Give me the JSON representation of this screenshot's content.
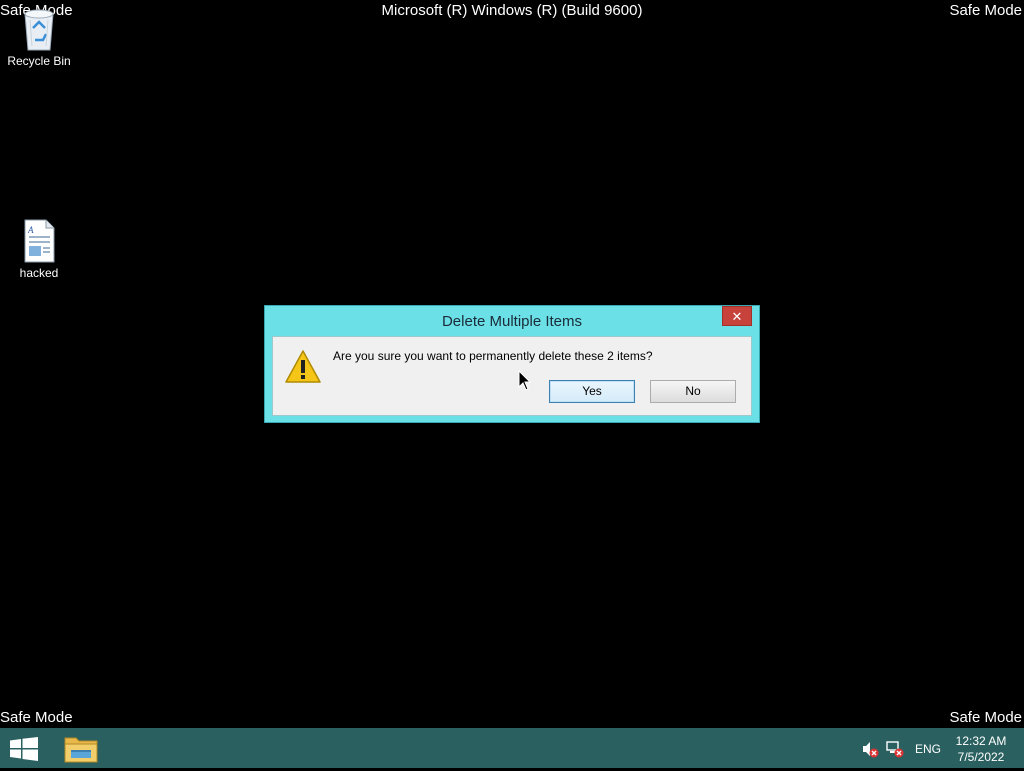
{
  "overlay": {
    "safe_mode_tl": "Safe Mode",
    "safe_mode_tr": "Safe Mode",
    "safe_mode_bl": "Safe Mode",
    "safe_mode_br": "Safe Mode",
    "build": "Microsoft (R) Windows (R) (Build 9600)"
  },
  "desktop": {
    "icons": [
      {
        "label": "Recycle Bin",
        "icon": "recycle-bin-icon"
      },
      {
        "label": "hacked",
        "icon": "document-icon"
      }
    ]
  },
  "dialog": {
    "title": "Delete Multiple Items",
    "close_label": "✕",
    "message": "Are you sure you want to permanently delete these 2 items?",
    "yes_label": "Yes",
    "no_label": "No",
    "icon": "warning-icon",
    "accent": "#6be0e6"
  },
  "taskbar": {
    "color": "#2b6060",
    "language": "ENG",
    "time": "12:32 AM",
    "date": "7/5/2022"
  }
}
